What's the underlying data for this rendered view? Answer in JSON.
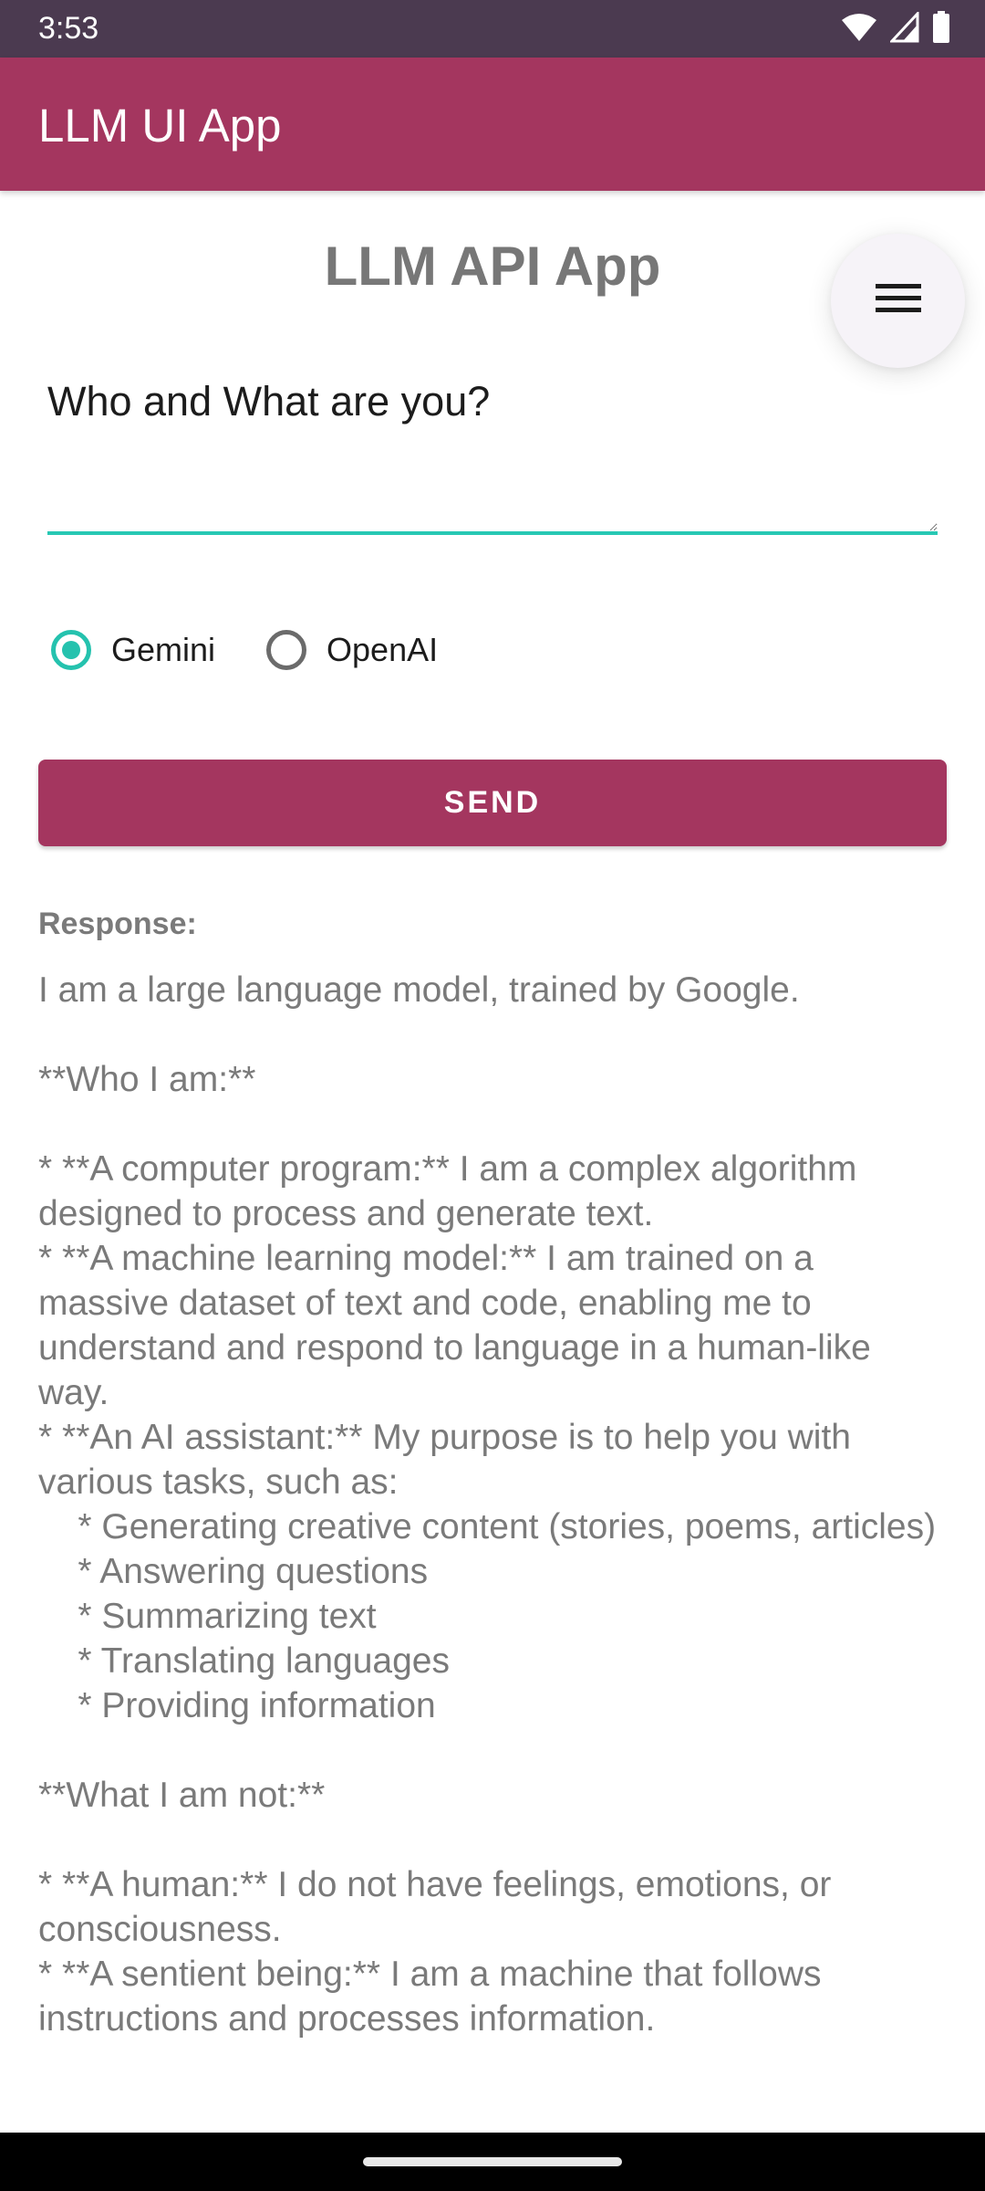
{
  "status_bar": {
    "time": "3:53",
    "icons": [
      "wifi-icon",
      "cellular-signal-icon",
      "battery-icon"
    ]
  },
  "app_bar": {
    "title": "LLM UI App"
  },
  "main": {
    "heading": "LLM API App",
    "menu_fab_icon": "menu-icon",
    "prompt_input": {
      "value": "Who and What are you?"
    },
    "model_options": [
      {
        "label": "Gemini",
        "selected": true
      },
      {
        "label": "OpenAI",
        "selected": false
      }
    ],
    "send_label": "SEND",
    "response_label": "Response:",
    "response_text": "I am a large language model, trained by Google.\n\n**Who I am:**\n\n* **A computer program:** I am a complex algorithm designed to process and generate text.\n* **A machine learning model:** I am trained on a massive dataset of text and code, enabling me to understand and respond to language in a human-like way.\n* **An AI assistant:** My purpose is to help you with various tasks, such as:\n    * Generating creative content (stories, poems, articles)\n    * Answering questions\n    * Summarizing text\n    * Translating languages\n    * Providing information\n\n**What I am not:**\n\n* **A human:** I do not have feelings, emotions, or consciousness.\n* **A sentient being:** I am a machine that follows instructions and processes information."
  },
  "colors": {
    "status_bar": "#4b3a50",
    "primary": "#a4365f",
    "accent": "#25c2ae",
    "response_text": "#7a7a7a"
  }
}
